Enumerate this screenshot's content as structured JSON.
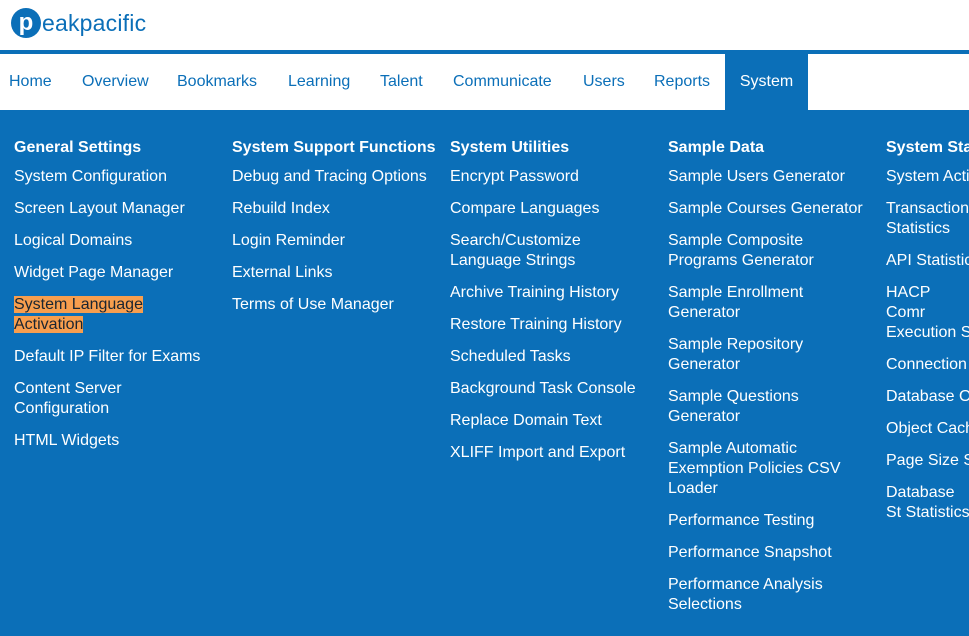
{
  "brand": {
    "logo_letter": "p",
    "logo_text": "eakpacific",
    "color": "#0b6fb8"
  },
  "colors": {
    "primary": "#0b6fb8",
    "highlight": "#f79e4e"
  },
  "nav": {
    "tabs": [
      {
        "label": "Home"
      },
      {
        "label": "Overview"
      },
      {
        "label": "Bookmarks"
      },
      {
        "label": "Learning"
      },
      {
        "label": "Talent"
      },
      {
        "label": "Communicate"
      },
      {
        "label": "Users"
      },
      {
        "label": "Reports"
      },
      {
        "label": "System"
      }
    ],
    "active": "System"
  },
  "menu": {
    "columns": [
      {
        "heading": "General Settings",
        "items": [
          "System Configuration",
          "Screen Layout Manager",
          "Logical Domains",
          "Widget Page Manager",
          "System Language Activation",
          "Default IP Filter for Exams",
          "Content Server Configuration",
          "HTML Widgets"
        ],
        "highlighted": "System Language Activation"
      },
      {
        "heading": "System Support Functions",
        "items": [
          "Debug and Tracing Options",
          "Rebuild Index",
          "Login Reminder",
          "External Links",
          "Terms of Use Manager"
        ]
      },
      {
        "heading": "System Utilities",
        "items": [
          "Encrypt Password",
          "Compare Languages",
          "Search/Customize Language Strings",
          "Archive Training History",
          "Restore Training History",
          "Scheduled Tasks",
          "Background Task Console",
          "Replace Domain Text",
          "XLIFF Import and Export"
        ]
      },
      {
        "heading": "Sample Data",
        "items": [
          "Sample Users Generator",
          "Sample Courses Generator",
          "Sample Composite Programs Generator",
          "Sample Enrollment Generator",
          "Sample Repository Generator",
          "Sample Questions Generator",
          "Sample Automatic Exemption Policies CSV Loader",
          "Performance Testing",
          "Performance Snapshot",
          "Performance Analysis Selections"
        ]
      },
      {
        "heading": "System Stat",
        "items": [
          "System Acti",
          "Transaction Statistics",
          "API Statistic",
          "HACP Comr Execution S",
          "Connection",
          "Database O",
          "Object Cach",
          "Page Size S",
          "Database St Statistics"
        ]
      }
    ]
  }
}
